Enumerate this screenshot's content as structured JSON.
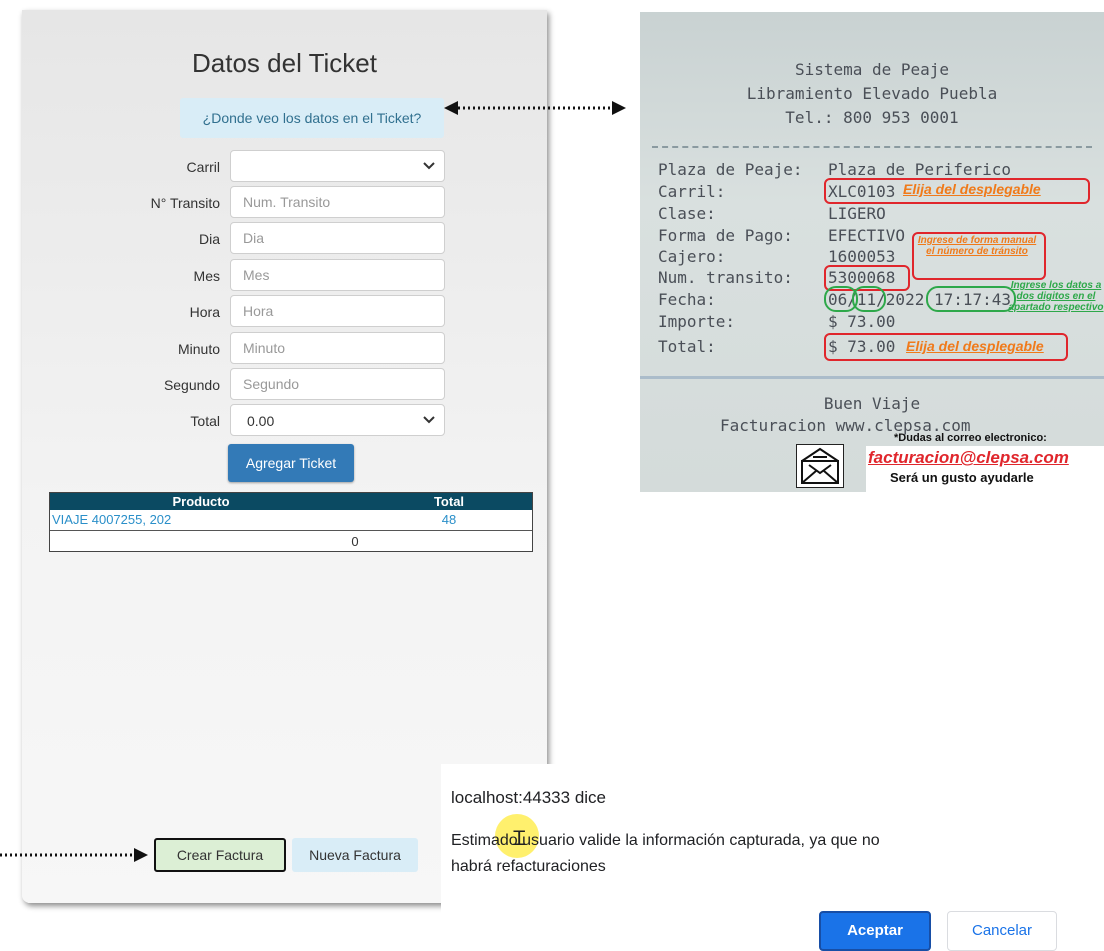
{
  "form": {
    "title": "Datos del Ticket",
    "help_button": "¿Donde veo los datos en el Ticket?",
    "fields": [
      {
        "label": "Carril",
        "type": "select",
        "value": ""
      },
      {
        "label": "N° Transito",
        "type": "input",
        "placeholder": "Num. Transito"
      },
      {
        "label": "Dia",
        "type": "input",
        "placeholder": "Dia"
      },
      {
        "label": "Mes",
        "type": "input",
        "placeholder": "Mes"
      },
      {
        "label": "Hora",
        "type": "input",
        "placeholder": "Hora"
      },
      {
        "label": "Minuto",
        "type": "input",
        "placeholder": "Minuto"
      },
      {
        "label": "Segundo",
        "type": "input",
        "placeholder": "Segundo"
      },
      {
        "label": "Total",
        "type": "select",
        "value": "0.00"
      }
    ],
    "add_button": "Agregar Ticket",
    "table": {
      "headers": [
        "Producto",
        "Total"
      ],
      "rows": [
        {
          "producto": "VIAJE 4007255, 202",
          "total": "48"
        }
      ],
      "footer_total": "0"
    },
    "crear_button": "Crear Factura",
    "nueva_button": "Nueva Factura"
  },
  "ticket": {
    "header_lines": [
      "Sistema de Peaje",
      "Libramiento Elevado Puebla",
      "Tel.: 800 953 0001"
    ],
    "lines": [
      {
        "label": "Plaza de Peaje:",
        "value": "Plaza de Periferico"
      },
      {
        "label": "Carril:",
        "value": "XLC0103"
      },
      {
        "label": "Clase:",
        "value": "LIGERO"
      },
      {
        "label": "Forma de Pago:",
        "value": "EFECTIVO"
      },
      {
        "label": "Cajero:",
        "value": "1600053"
      },
      {
        "label": "Num. transito:",
        "value": "5300068"
      },
      {
        "label": "Fecha:",
        "value": "06/11/2022 17:17:43"
      },
      {
        "label": "Importe:",
        "value": "$  73.00"
      },
      {
        "label": "Total:",
        "value": "$  73.00"
      }
    ],
    "annotation_select": "Elija del desplegable",
    "annotation_manual": "Ingrese de forma manual el número de tránsito",
    "annotation_dates": "Ingrese los datos a dos digitos en el apartado respectivo",
    "footer_lines": [
      "Buen Viaje",
      "Facturacion www.clepsa.com"
    ],
    "dudas": "*Dudas al correo electronico:",
    "email": "facturacion@clepsa.com",
    "gusto": "Será un gusto ayudarle"
  },
  "dialog": {
    "title": "localhost:44333 dice",
    "message": "Estimado usuario valide la información capturada, ya que no habrá refacturaciones",
    "accept": "Aceptar",
    "cancel": "Cancelar"
  }
}
